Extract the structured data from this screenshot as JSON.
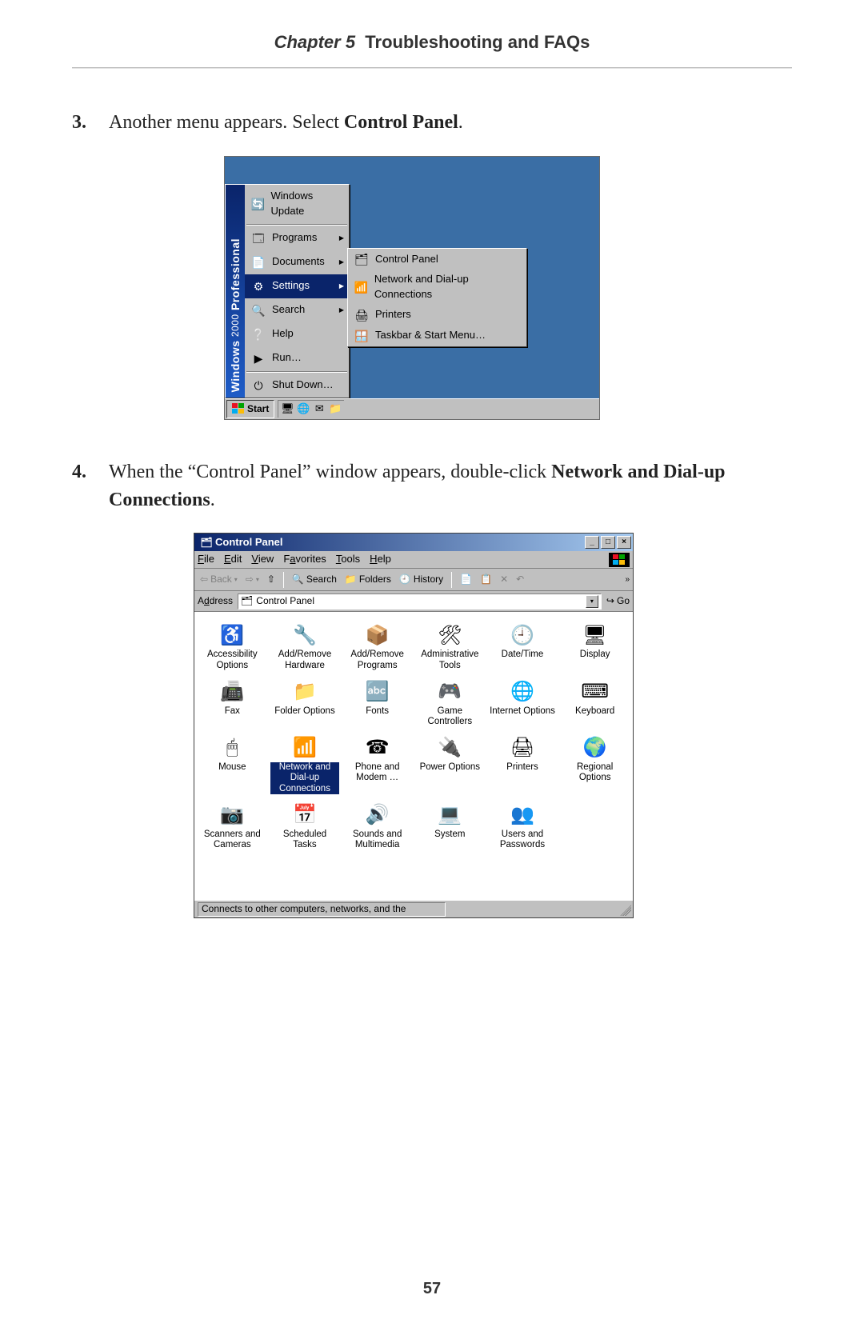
{
  "header": {
    "chapter": "Chapter 5",
    "title": "Troubleshooting and FAQs"
  },
  "page_number": "57",
  "steps": {
    "s3": {
      "num": "3.",
      "pre": "Another menu appears. Select ",
      "bold": "Control Panel",
      "post": "."
    },
    "s4": {
      "num": "4.",
      "pre": "When the “Control Panel” window appears, double-click ",
      "bold": "Network and Dial-up Connections",
      "post": "."
    }
  },
  "fig1": {
    "sidebar_brand": "Windows",
    "sidebar_sub": "2000",
    "sidebar_edition": "Professional",
    "items": {
      "wu": "Windows Update",
      "prg": "Programs",
      "doc": "Documents",
      "set": "Settings",
      "srch": "Search",
      "help": "Help",
      "run": "Run…",
      "shut": "Shut Down…"
    },
    "submenu": {
      "cp": "Control Panel",
      "net": "Network and Dial-up Connections",
      "prn": "Printers",
      "tb": "Taskbar & Start Menu…"
    },
    "taskbar": {
      "start": "Start"
    }
  },
  "fig2": {
    "title": "Control Panel",
    "menu": {
      "file": "File",
      "edit": "Edit",
      "view": "View",
      "fav": "Favorites",
      "tools": "Tools",
      "help": "Help"
    },
    "toolbar": {
      "back": "Back",
      "search": "Search",
      "folders": "Folders",
      "history": "History"
    },
    "address": {
      "label": "Address",
      "value": "Control Panel",
      "go": "Go"
    },
    "items": [
      {
        "k": "access",
        "label": "Accessibility Options",
        "icon": "♿"
      },
      {
        "k": "arhw",
        "label": "Add/Remove Hardware",
        "icon": "🔧"
      },
      {
        "k": "arprg",
        "label": "Add/Remove Programs",
        "icon": "📦"
      },
      {
        "k": "admin",
        "label": "Administrative Tools",
        "icon": "🛠"
      },
      {
        "k": "dt",
        "label": "Date/Time",
        "icon": "🕘"
      },
      {
        "k": "disp",
        "label": "Display",
        "icon": "🖥"
      },
      {
        "k": "fax",
        "label": "Fax",
        "icon": "📠"
      },
      {
        "k": "fopt",
        "label": "Folder Options",
        "icon": "📁"
      },
      {
        "k": "fonts",
        "label": "Fonts",
        "icon": "🔤"
      },
      {
        "k": "game",
        "label": "Game Controllers",
        "icon": "🎮"
      },
      {
        "k": "inet",
        "label": "Internet Options",
        "icon": "🌐"
      },
      {
        "k": "kbd",
        "label": "Keyboard",
        "icon": "⌨"
      },
      {
        "k": "mouse",
        "label": "Mouse",
        "icon": "🖱"
      },
      {
        "k": "net",
        "label": "Network and Dial-up Connections",
        "icon": "📶",
        "selected": true
      },
      {
        "k": "phone",
        "label": "Phone and Modem …",
        "icon": "☎"
      },
      {
        "k": "power",
        "label": "Power Options",
        "icon": "🔌"
      },
      {
        "k": "prn",
        "label": "Printers",
        "icon": "🖨"
      },
      {
        "k": "reg",
        "label": "Regional Options",
        "icon": "🌍"
      },
      {
        "k": "scan",
        "label": "Scanners and Cameras",
        "icon": "📷"
      },
      {
        "k": "sched",
        "label": "Scheduled Tasks",
        "icon": "📅"
      },
      {
        "k": "sound",
        "label": "Sounds and Multimedia",
        "icon": "🔊"
      },
      {
        "k": "sys",
        "label": "System",
        "icon": "💻"
      },
      {
        "k": "users",
        "label": "Users and Passwords",
        "icon": "👥"
      }
    ],
    "status": "Connects to other computers, networks, and the"
  }
}
